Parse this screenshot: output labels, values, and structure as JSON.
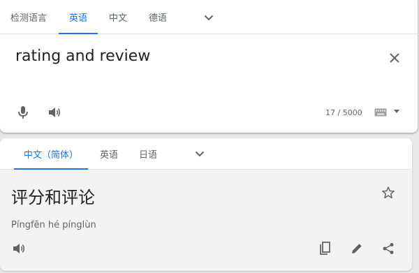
{
  "source": {
    "tabs": [
      {
        "label": "检测语言",
        "active": false
      },
      {
        "label": "英语",
        "active": true
      },
      {
        "label": "中文",
        "active": false
      },
      {
        "label": "德语",
        "active": false
      }
    ],
    "text": "rating and review",
    "char_count": "17 / 5000"
  },
  "target": {
    "tabs": [
      {
        "label": "中文（简体）",
        "active": true
      },
      {
        "label": "英语",
        "active": false
      },
      {
        "label": "日语",
        "active": false
      }
    ],
    "text": "评分和评论",
    "romanization": "Píngfēn hé pínglùn"
  },
  "icons": {
    "source_lang_more": "chevron-down-icon",
    "target_lang_more": "chevron-down-icon",
    "clear": "close-icon",
    "mic": "microphone-icon",
    "listen": "speaker-icon",
    "keyboard": "keyboard-icon",
    "star": "star-icon",
    "copy": "copy-icon",
    "edit": "pencil-icon",
    "share": "share-icon"
  },
  "colors": {
    "accent": "#1a73e8",
    "icon": "#5f6368",
    "text": "#202124"
  }
}
